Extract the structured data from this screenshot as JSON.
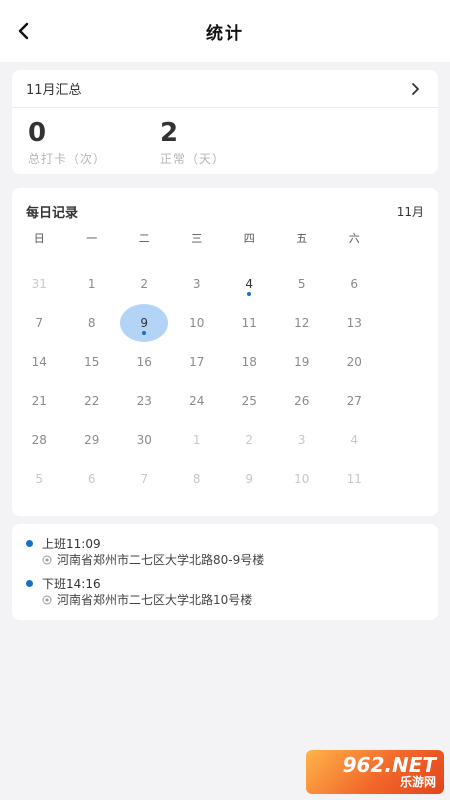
{
  "header": {
    "title": "统计"
  },
  "summary": {
    "title": "11月汇总",
    "stats": [
      {
        "value": "0",
        "label": "总打卡（次）"
      },
      {
        "value": "2",
        "label": "正常（天）"
      }
    ]
  },
  "calendar": {
    "title": "每日记录",
    "month": "11月",
    "weekdays": [
      "日",
      "一",
      "二",
      "三",
      "四",
      "五",
      "六"
    ],
    "days": [
      {
        "d": "31",
        "other": true
      },
      {
        "d": "1"
      },
      {
        "d": "2"
      },
      {
        "d": "3"
      },
      {
        "d": "4",
        "dot": true,
        "active": true
      },
      {
        "d": "5"
      },
      {
        "d": "6"
      },
      {
        "d": "7"
      },
      {
        "d": "8"
      },
      {
        "d": "9",
        "dot": true,
        "selected": true,
        "active": true
      },
      {
        "d": "10"
      },
      {
        "d": "11"
      },
      {
        "d": "12"
      },
      {
        "d": "13"
      },
      {
        "d": "14"
      },
      {
        "d": "15"
      },
      {
        "d": "16"
      },
      {
        "d": "17"
      },
      {
        "d": "18"
      },
      {
        "d": "19"
      },
      {
        "d": "20"
      },
      {
        "d": "21"
      },
      {
        "d": "22"
      },
      {
        "d": "23"
      },
      {
        "d": "24"
      },
      {
        "d": "25"
      },
      {
        "d": "26"
      },
      {
        "d": "27"
      },
      {
        "d": "28"
      },
      {
        "d": "29"
      },
      {
        "d": "30"
      },
      {
        "d": "1",
        "other": true
      },
      {
        "d": "2",
        "other": true
      },
      {
        "d": "3",
        "other": true
      },
      {
        "d": "4",
        "other": true
      },
      {
        "d": "5",
        "other": true
      },
      {
        "d": "6",
        "other": true
      },
      {
        "d": "7",
        "other": true
      },
      {
        "d": "8",
        "other": true
      },
      {
        "d": "9",
        "other": true
      },
      {
        "d": "10",
        "other": true
      },
      {
        "d": "11",
        "other": true
      }
    ]
  },
  "records": [
    {
      "time": "上班11:09",
      "location": "河南省郑州市二七区大学北路80-9号楼"
    },
    {
      "time": "下班14:16",
      "location": "河南省郑州市二七区大学北路10号楼"
    }
  ],
  "watermark": {
    "brand": "962.NET",
    "sub": "乐游网"
  },
  "colors": {
    "accent": "#1a6fc4",
    "selected_bg": "#b3d4f7",
    "background": "#f3f3f5"
  }
}
